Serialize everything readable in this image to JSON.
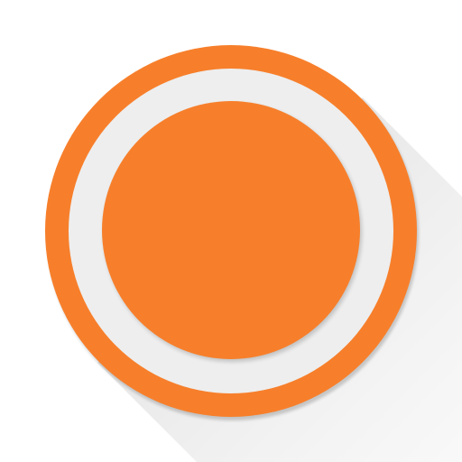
{
  "icon": {
    "name": "record-icon",
    "colors": {
      "outer_ring": "#f77f2b",
      "inner_ring": "#eeeeee",
      "center_disc": "#f77f2b",
      "long_shadow": "#dedede",
      "background": "#ffffff"
    }
  }
}
